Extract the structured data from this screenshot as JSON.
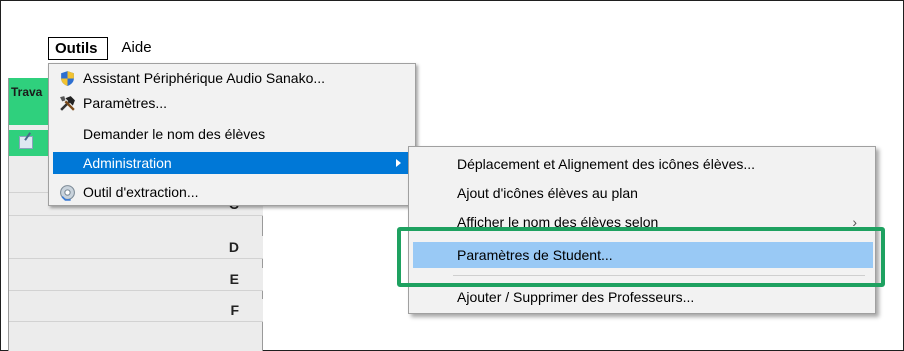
{
  "menubar": {
    "outils_label": "Outils",
    "aide_label": "Aide"
  },
  "left_panel": {
    "header_text": "Trava",
    "rows": [
      "C",
      "D",
      "E",
      "F"
    ]
  },
  "outils_menu": {
    "items": [
      {
        "label": "Assistant Périphérique Audio Sanako...",
        "icon": "shield-icon"
      },
      {
        "label": "Paramètres...",
        "icon": "tools-icon"
      },
      {
        "label": "Demander le nom des élèves",
        "icon": ""
      },
      {
        "label": "Administration",
        "icon": "",
        "submenu": true,
        "highlighted": true
      },
      {
        "label": "Outil d'extraction...",
        "icon": "extraction-icon"
      }
    ]
  },
  "administration_submenu": {
    "items": [
      {
        "label": "Déplacement et Alignement des icônes élèves..."
      },
      {
        "label": "Ajout d'icônes élèves au plan"
      },
      {
        "label": "Afficher le nom des élèves selon",
        "chevron": "›"
      },
      {
        "label": "Paramètres de Student...",
        "hover": true
      },
      {
        "label": "Ajouter / Supprimer des Professeurs..."
      }
    ]
  },
  "colors": {
    "accent_green": "#2fd07d",
    "highlight_box": "#1ea160",
    "menu_selection": "#0078d7",
    "submenu_hover": "#99c9f5"
  }
}
